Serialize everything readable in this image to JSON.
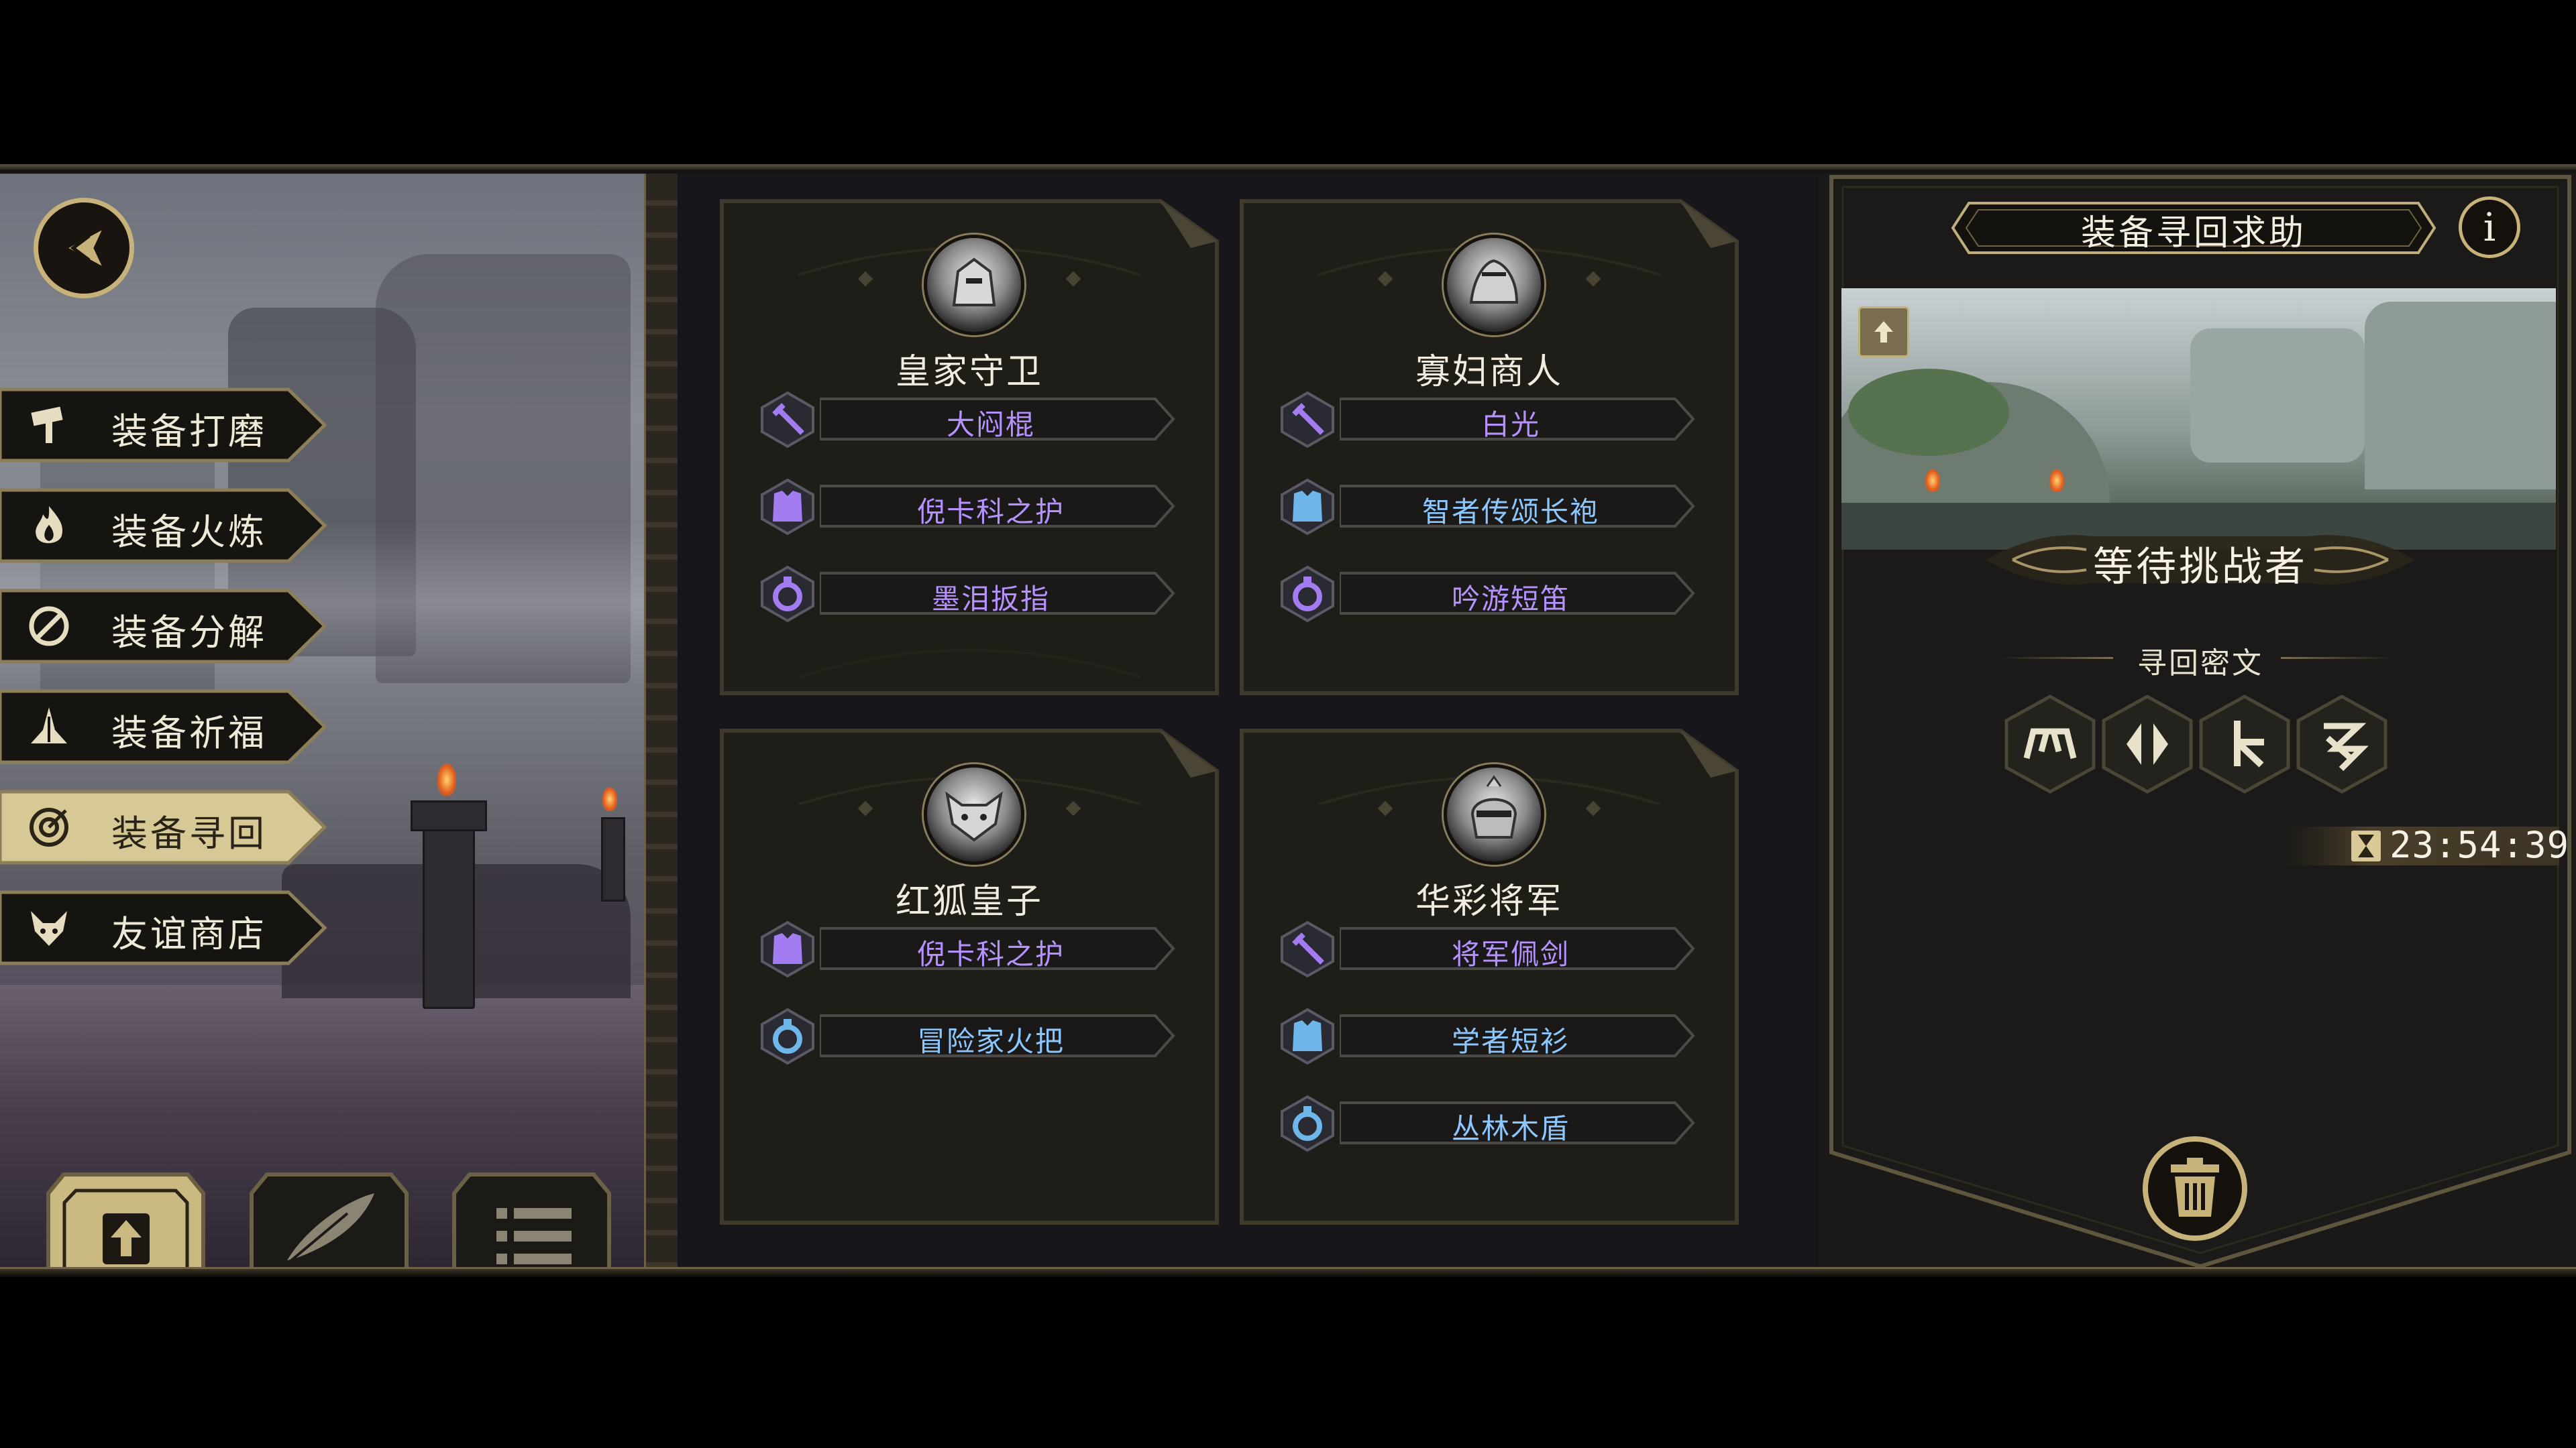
{
  "left_menu": [
    {
      "label": "装备打磨",
      "icon": "hammer-icon",
      "active": false
    },
    {
      "label": "装备火炼",
      "icon": "flame-icon",
      "active": false
    },
    {
      "label": "装备分解",
      "icon": "disassemble-icon",
      "active": false
    },
    {
      "label": "装备祈福",
      "icon": "prayer-icon",
      "active": false
    },
    {
      "label": "装备寻回",
      "icon": "target-icon",
      "active": true
    },
    {
      "label": "友谊商店",
      "icon": "fox-icon",
      "active": false
    }
  ],
  "bottom_buttons": [
    "upload-icon",
    "feather-icon",
    "list-icon"
  ],
  "cards": [
    {
      "name": "皇家守卫",
      "items": [
        {
          "label": "大闷棍",
          "type": "weapon",
          "color": "purple"
        },
        {
          "label": "倪卡科之护",
          "type": "armor",
          "color": "purple"
        },
        {
          "label": "墨泪扳指",
          "type": "ring",
          "color": "purple"
        }
      ]
    },
    {
      "name": "寡妇商人",
      "items": [
        {
          "label": "白光",
          "type": "weapon",
          "color": "purple"
        },
        {
          "label": "智者传颂长袍",
          "type": "armor",
          "color": "blue"
        },
        {
          "label": "吟游短笛",
          "type": "ring",
          "color": "purple"
        }
      ]
    },
    {
      "name": "红狐皇子",
      "items": [
        {
          "label": "倪卡科之护",
          "type": "armor",
          "color": "purple"
        },
        {
          "label": "冒险家火把",
          "type": "ring",
          "color": "blue"
        }
      ]
    },
    {
      "name": "华彩将军",
      "items": [
        {
          "label": "将军佩剑",
          "type": "weapon",
          "color": "purple"
        },
        {
          "label": "学者短衫",
          "type": "armor",
          "color": "blue"
        },
        {
          "label": "丛林木盾",
          "type": "ring",
          "color": "blue"
        }
      ]
    }
  ],
  "right_panel": {
    "title": "装备寻回求助",
    "info_label": "i",
    "status": "等待挑战者",
    "cipher_label": "寻回密文",
    "runes": [
      "rune-1-icon",
      "rune-2-icon",
      "rune-3-icon",
      "rune-4-icon"
    ],
    "timer": "23:54:39"
  },
  "colors": {
    "gold": "#c7b37a",
    "purple_text": "#b692ff",
    "blue_text": "#8cc8ff",
    "active_menu": "#d6c995"
  }
}
